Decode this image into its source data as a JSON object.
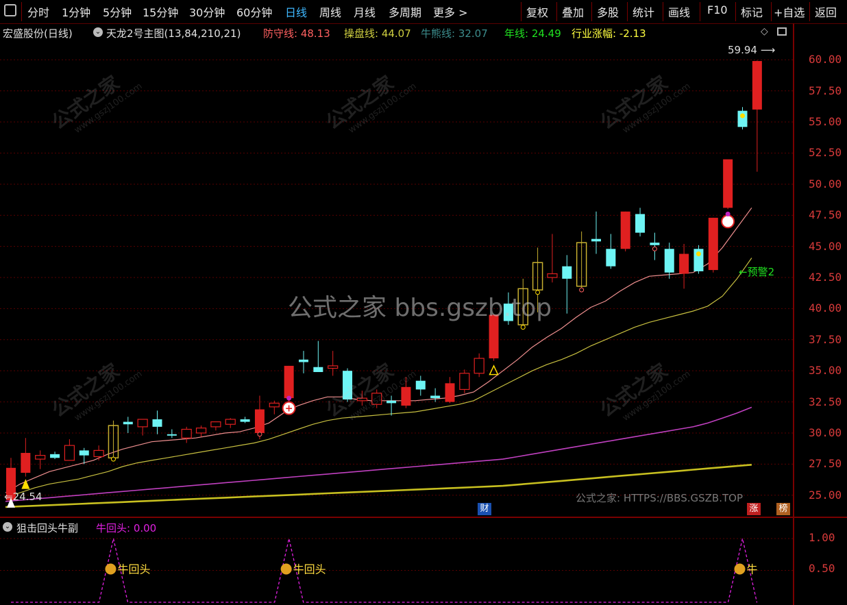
{
  "toolbar": {
    "layout_icon": "layout-toggle-icon",
    "periods": [
      "分时",
      "1分钟",
      "5分钟",
      "15分钟",
      "30分钟",
      "60分钟",
      "日线",
      "周线",
      "月线",
      "多周期",
      "更多 >"
    ],
    "active_period": "日线",
    "actions": [
      "复权",
      "叠加",
      "多股",
      "统计",
      "画线",
      "F10",
      "标记",
      "+自选",
      "返回"
    ]
  },
  "info": {
    "stock_name": "宏盛股份(日线)",
    "indicator_name": "天龙2号主图(13,84,210,21)",
    "defense_label": "防守线: 48.13",
    "operate_label": "操盘线: 44.07",
    "bull_bear_label": "牛熊线: 32.07",
    "year_label": "年线: 24.49",
    "industry_label": "行业涨幅: -2.13",
    "colors": {
      "defense": "#ff6060",
      "operate": "#d0d040",
      "bull_bear": "#3c8c8c",
      "year": "#20e020",
      "industry": "#ffff40"
    }
  },
  "price_axis": [
    "60.00",
    "57.50",
    "55.00",
    "52.50",
    "50.00",
    "47.50",
    "45.00",
    "42.50",
    "40.00",
    "37.50",
    "35.00",
    "32.50",
    "30.00",
    "27.50",
    "25.00"
  ],
  "annotations": {
    "high_label": "59.94",
    "low_label": "24.54",
    "warning_label": "←预警2",
    "watermark_big": "公式之家 bbs.gszb.top",
    "watermark_text": "公式之家",
    "watermark_url": "www.gszj100.com",
    "footer_url": "公式之家: HTTPS://BBS.GSZB.TOP",
    "badge_finance": "财",
    "badge_rise": "涨",
    "badge_rank": "榜"
  },
  "sub_panel": {
    "title": "狙击回头牛副",
    "value_label": "牛回头: 0.00",
    "signal_labels": [
      "牛回头",
      "牛回头",
      "牛"
    ],
    "axis": [
      "1.00",
      "0.50"
    ]
  },
  "chart_data": {
    "type": "candlestick",
    "ylim": [
      23.5,
      61.5
    ],
    "candles": [
      {
        "o": 24.6,
        "h": 28.0,
        "l": 24.5,
        "c": 27.2,
        "color": "red"
      },
      {
        "o": 26.8,
        "h": 29.6,
        "l": 26.5,
        "c": 28.4,
        "color": "red"
      },
      {
        "o": 27.9,
        "h": 28.6,
        "l": 27.1,
        "c": 28.2,
        "color": "red"
      },
      {
        "o": 28.3,
        "h": 28.5,
        "l": 27.9,
        "c": 28.0,
        "color": "cyan"
      },
      {
        "o": 27.8,
        "h": 29.5,
        "l": 27.8,
        "c": 29.0,
        "color": "red"
      },
      {
        "o": 28.6,
        "h": 28.8,
        "l": 27.5,
        "c": 28.2,
        "color": "cyan"
      },
      {
        "o": 28.1,
        "h": 29.0,
        "l": 27.8,
        "c": 28.6,
        "color": "red"
      },
      {
        "o": 28.0,
        "h": 31.0,
        "l": 27.9,
        "c": 30.6,
        "color": "yellow"
      },
      {
        "o": 30.9,
        "h": 31.3,
        "l": 30.0,
        "c": 30.7,
        "color": "cyan"
      },
      {
        "o": 30.5,
        "h": 31.1,
        "l": 29.8,
        "c": 31.1,
        "color": "red"
      },
      {
        "o": 31.1,
        "h": 31.8,
        "l": 29.9,
        "c": 30.5,
        "color": "cyan"
      },
      {
        "o": 29.9,
        "h": 30.3,
        "l": 29.6,
        "c": 29.9,
        "color": "cyan"
      },
      {
        "o": 29.6,
        "h": 30.5,
        "l": 29.2,
        "c": 30.3,
        "color": "red"
      },
      {
        "o": 30.0,
        "h": 30.6,
        "l": 29.7,
        "c": 30.4,
        "color": "red"
      },
      {
        "o": 30.5,
        "h": 30.9,
        "l": 30.2,
        "c": 30.9,
        "color": "red"
      },
      {
        "o": 30.7,
        "h": 31.2,
        "l": 30.4,
        "c": 31.1,
        "color": "red"
      },
      {
        "o": 31.1,
        "h": 31.3,
        "l": 30.8,
        "c": 30.9,
        "color": "cyan"
      },
      {
        "o": 30.0,
        "h": 33.0,
        "l": 29.5,
        "c": 31.9,
        "color": "red"
      },
      {
        "o": 32.1,
        "h": 32.6,
        "l": 31.5,
        "c": 32.4,
        "color": "red"
      },
      {
        "o": 32.8,
        "h": 35.4,
        "l": 32.5,
        "c": 35.4,
        "color": "red"
      },
      {
        "o": 35.9,
        "h": 36.6,
        "l": 34.8,
        "c": 35.7,
        "color": "cyan"
      },
      {
        "o": 35.3,
        "h": 37.4,
        "l": 35.1,
        "c": 34.9,
        "color": "cyan"
      },
      {
        "o": 35.2,
        "h": 36.6,
        "l": 34.6,
        "c": 35.4,
        "color": "red"
      },
      {
        "o": 35.0,
        "h": 35.2,
        "l": 32.5,
        "c": 32.7,
        "color": "cyan"
      },
      {
        "o": 32.6,
        "h": 33.4,
        "l": 32.2,
        "c": 32.8,
        "color": "red"
      },
      {
        "o": 32.3,
        "h": 33.5,
        "l": 32.0,
        "c": 33.2,
        "color": "red"
      },
      {
        "o": 32.6,
        "h": 33.0,
        "l": 31.4,
        "c": 32.4,
        "color": "cyan"
      },
      {
        "o": 32.2,
        "h": 34.5,
        "l": 32.0,
        "c": 33.7,
        "color": "red"
      },
      {
        "o": 34.2,
        "h": 34.6,
        "l": 33.0,
        "c": 33.5,
        "color": "cyan"
      },
      {
        "o": 33.0,
        "h": 33.6,
        "l": 32.5,
        "c": 32.8,
        "color": "cyan"
      },
      {
        "o": 32.5,
        "h": 34.5,
        "l": 32.4,
        "c": 34.0,
        "color": "red"
      },
      {
        "o": 33.5,
        "h": 35.1,
        "l": 33.2,
        "c": 34.8,
        "color": "red"
      },
      {
        "o": 34.8,
        "h": 36.4,
        "l": 34.5,
        "c": 36.0,
        "color": "red"
      },
      {
        "o": 36.0,
        "h": 39.5,
        "l": 35.8,
        "c": 39.5,
        "color": "red"
      },
      {
        "o": 40.4,
        "h": 41.3,
        "l": 38.7,
        "c": 39.0,
        "color": "cyan"
      },
      {
        "o": 38.7,
        "h": 42.4,
        "l": 38.6,
        "c": 41.6,
        "color": "yellow"
      },
      {
        "o": 41.5,
        "h": 44.9,
        "l": 39.7,
        "c": 43.7,
        "color": "yellow"
      },
      {
        "o": 42.5,
        "h": 46.0,
        "l": 42.1,
        "c": 42.8,
        "color": "red"
      },
      {
        "o": 42.4,
        "h": 44.3,
        "l": 39.6,
        "c": 43.4,
        "color": "cyan"
      },
      {
        "o": 41.8,
        "h": 46.2,
        "l": 41.5,
        "c": 45.3,
        "color": "yellow"
      },
      {
        "o": 45.6,
        "h": 47.8,
        "l": 44.4,
        "c": 45.4,
        "color": "cyan"
      },
      {
        "o": 44.8,
        "h": 46.0,
        "l": 43.2,
        "c": 43.4,
        "color": "cyan"
      },
      {
        "o": 44.8,
        "h": 47.8,
        "l": 44.6,
        "c": 47.8,
        "color": "red"
      },
      {
        "o": 47.6,
        "h": 48.1,
        "l": 45.8,
        "c": 46.1,
        "color": "cyan"
      },
      {
        "o": 45.3,
        "h": 46.1,
        "l": 43.9,
        "c": 45.1,
        "color": "cyan"
      },
      {
        "o": 44.8,
        "h": 45.3,
        "l": 42.4,
        "c": 42.9,
        "color": "cyan"
      },
      {
        "o": 42.8,
        "h": 45.2,
        "l": 41.6,
        "c": 44.4,
        "color": "red"
      },
      {
        "o": 43.0,
        "h": 45.1,
        "l": 42.8,
        "c": 44.8,
        "color": "cyan"
      },
      {
        "o": 43.1,
        "h": 47.3,
        "l": 42.9,
        "c": 47.3,
        "color": "red"
      },
      {
        "o": 48.1,
        "h": 52.0,
        "l": 48.0,
        "c": 52.0,
        "color": "red"
      },
      {
        "o": 55.9,
        "h": 56.2,
        "l": 54.4,
        "c": 54.6,
        "color": "cyan"
      },
      {
        "o": 56.0,
        "h": 59.94,
        "l": 51.0,
        "c": 59.9,
        "color": "red"
      }
    ],
    "lines": {
      "defense": [
        25.2,
        25.9,
        26.4,
        26.9,
        27.2,
        27.5,
        27.8,
        28.3,
        28.7,
        29.0,
        29.3,
        29.4,
        29.5,
        29.6,
        29.8,
        30.0,
        30.1,
        30.4,
        30.8,
        31.6,
        32.2,
        32.6,
        32.9,
        32.9,
        32.7,
        32.6,
        32.6,
        32.6,
        32.6,
        32.7,
        32.8,
        33.0,
        33.3,
        34.1,
        35.0,
        35.9,
        36.9,
        37.7,
        38.4,
        39.3,
        40.1,
        40.6,
        41.4,
        42.1,
        42.6,
        42.7,
        42.8,
        42.9,
        43.6,
        44.9,
        46.5,
        48.1
      ],
      "operate": [
        24.8,
        25.2,
        25.6,
        25.9,
        26.1,
        26.3,
        26.6,
        26.9,
        27.3,
        27.6,
        27.8,
        28.0,
        28.2,
        28.4,
        28.6,
        28.8,
        29.0,
        29.2,
        29.5,
        29.9,
        30.3,
        30.7,
        31.0,
        31.2,
        31.3,
        31.4,
        31.5,
        31.6,
        31.7,
        31.9,
        32.1,
        32.3,
        32.6,
        33.2,
        33.8,
        34.4,
        35.0,
        35.5,
        35.9,
        36.4,
        37.0,
        37.5,
        38.0,
        38.5,
        38.9,
        39.2,
        39.5,
        39.8,
        40.2,
        41.0,
        42.4,
        44.07
      ],
      "bull_bear": [
        24.5,
        24.6,
        24.7,
        24.8,
        24.9,
        25.0,
        25.1,
        25.2,
        25.3,
        25.4,
        25.5,
        25.6,
        25.7,
        25.8,
        25.9,
        26.0,
        26.1,
        26.2,
        26.3,
        26.4,
        26.5,
        26.6,
        26.7,
        26.8,
        26.9,
        27.0,
        27.1,
        27.2,
        27.3,
        27.4,
        27.5,
        27.6,
        27.7,
        27.8,
        27.9,
        28.1,
        28.3,
        28.5,
        28.7,
        28.9,
        29.1,
        29.3,
        29.5,
        29.7,
        29.9,
        30.1,
        30.3,
        30.5,
        30.8,
        31.2,
        31.6,
        32.07
      ],
      "year": [
        24.05,
        24.1,
        24.15,
        24.2,
        24.25,
        24.3,
        24.35,
        24.4,
        24.45,
        24.5,
        24.55,
        24.6,
        24.65,
        24.7,
        24.75,
        24.8,
        24.85,
        24.9,
        24.95,
        25.0,
        25.05,
        25.1,
        25.15,
        25.2,
        25.25,
        25.3,
        25.35,
        25.4,
        25.45,
        25.5,
        25.55,
        25.6,
        25.65,
        25.7,
        25.75,
        25.85,
        25.95,
        26.05,
        26.15,
        26.25,
        26.35,
        26.45,
        26.55,
        26.65,
        26.75,
        26.85,
        26.95,
        27.05,
        27.15,
        27.25,
        27.35,
        27.45
      ]
    },
    "sub_signal": [
      0,
      0,
      0,
      0,
      0,
      0,
      0,
      1,
      0,
      0,
      0,
      0,
      0,
      0,
      0,
      0,
      0,
      0,
      0,
      1,
      0,
      0,
      0,
      0,
      0,
      0,
      0,
      0,
      0,
      0,
      0,
      0,
      0,
      0,
      0,
      0,
      0,
      0,
      0,
      0,
      0,
      0,
      0,
      0,
      0,
      0,
      0,
      0,
      0,
      0,
      1,
      0
    ]
  }
}
